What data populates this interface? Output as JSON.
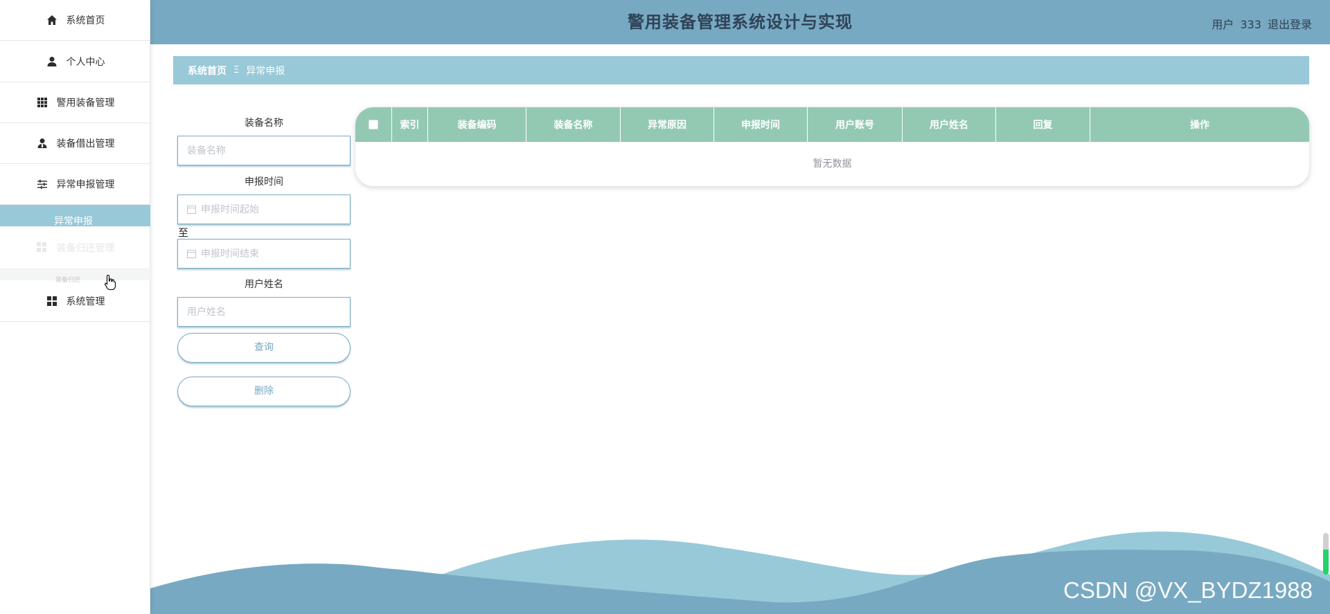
{
  "header": {
    "title": "警用装备管理系统设计与实现",
    "user_prefix": "用户",
    "user_name": "333",
    "logout_label": "退出登录"
  },
  "sidebar": {
    "items": [
      {
        "label": "系统首页",
        "icon": "home-icon"
      },
      {
        "label": "个人中心",
        "icon": "person-icon"
      },
      {
        "label": "警用装备管理",
        "icon": "grid-icon"
      },
      {
        "label": "装备借出管理",
        "icon": "person-tie-icon"
      },
      {
        "label": "异常申报管理",
        "icon": "sliders-icon"
      }
    ],
    "active_sub": "异常申报",
    "ghost_label": "装备归还管理",
    "ghost_sub": "装备归还",
    "system_label": "系统管理"
  },
  "breadcrumb": {
    "home": "系统首页",
    "separator": "Ξ",
    "current": "异常申报"
  },
  "search": {
    "equipment_name_label": "装备名称",
    "equipment_name_placeholder": "装备名称",
    "report_time_label": "申报时间",
    "start_placeholder": "申报时间起始",
    "range_separator": "至",
    "end_placeholder": "申报时间结束",
    "user_name_label": "用户姓名",
    "user_name_placeholder": "用户姓名",
    "query_button": "查询",
    "delete_button": "删除"
  },
  "table": {
    "columns": [
      "索引",
      "装备编码",
      "装备名称",
      "异常原因",
      "申报时间",
      "用户账号",
      "用户姓名",
      "回复",
      "操作"
    ],
    "empty_text": "暂无数据"
  },
  "watermark": "CSDN @VX_BYDZ1988",
  "colors": {
    "header": "#78a9c2",
    "breadcrumb": "#98c9d8",
    "table_header": "#93c9b3",
    "wave_front": "#78a9c2",
    "wave_back": "#98c9d8"
  }
}
